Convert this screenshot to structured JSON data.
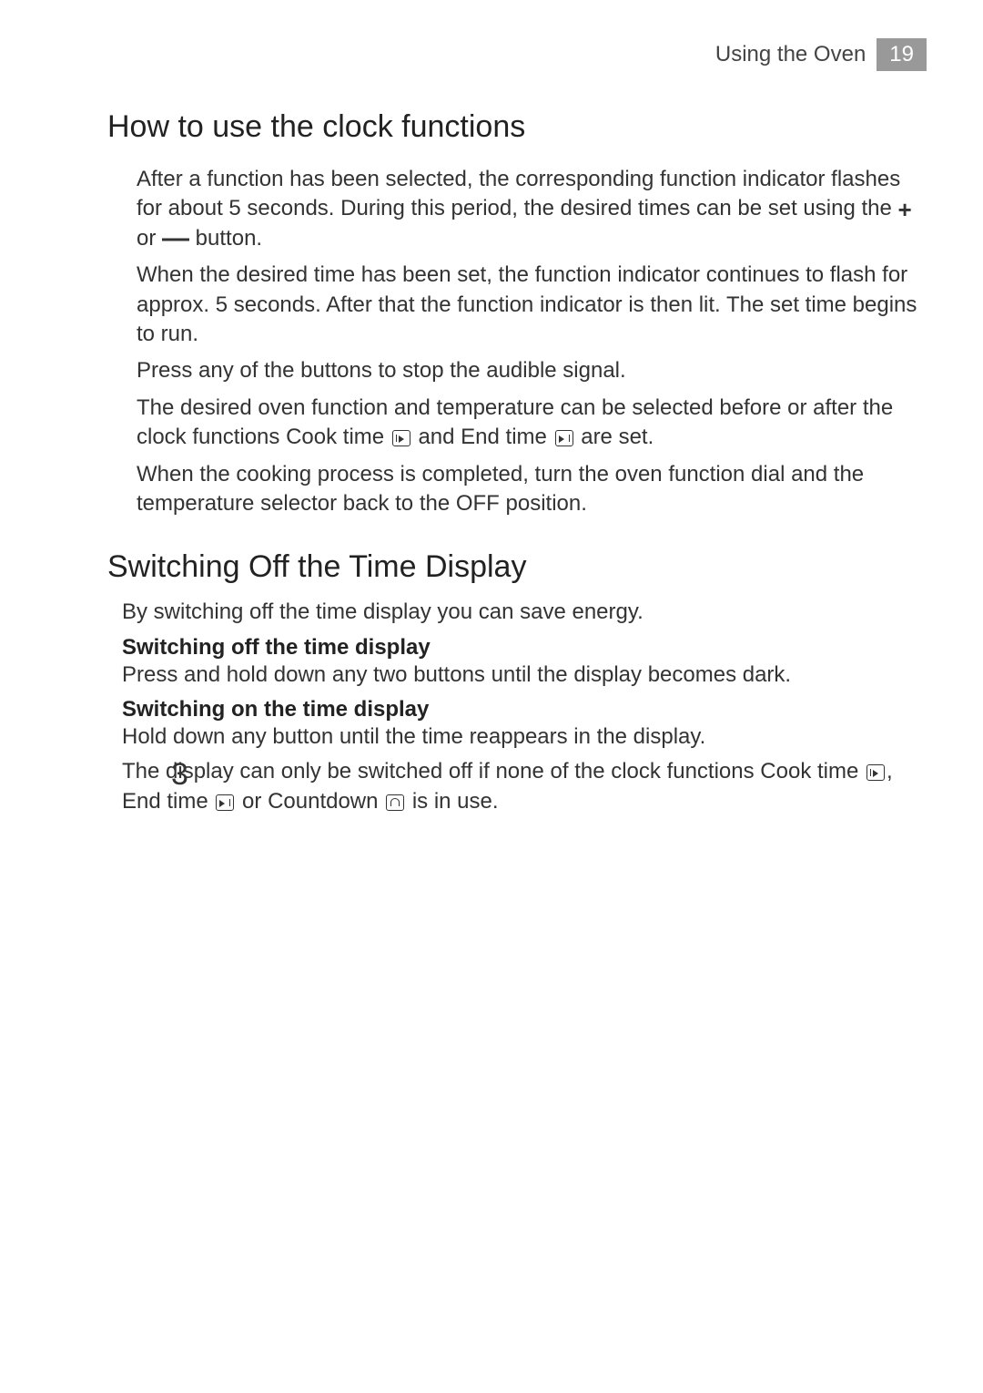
{
  "header": {
    "title": "Using the Oven",
    "page_number": "19"
  },
  "section1": {
    "heading": "How to use the clock functions",
    "p1a": "After a function has been selected, the corresponding function indicator flashes for about 5 seconds. During this period, the desired times can be set using the ",
    "p1b": " or ",
    "p1c": " button.",
    "p2": "When the desired time has been set, the function indicator continues to flash for approx. 5 seconds. After that the function indicator is then lit. The set time begins to run.",
    "p3": "Press any of the buttons to stop the audible signal.",
    "p4a": "The desired oven function and temperature can be selected before or after the clock functions Cook time ",
    "p4b": " and End time ",
    "p4c": " are set.",
    "p5": "When the cooking process is completed, turn the oven function dial and the temperature selector back to the OFF position."
  },
  "section2": {
    "heading": "Switching Off the Time Display",
    "intro": "By switching off the time display you can save energy.",
    "sub1_title": "Switching off the time display",
    "sub1_text": "Press and hold down any two buttons until the display becomes dark.",
    "sub2_title": "Switching on the time display",
    "sub2_text": "Hold down any button until the time reappears in the display.",
    "note_number": "3",
    "note_a": "The display can only be switched off if none of the clock functions Cook time ",
    "note_b": ", End time ",
    "note_c": " or Countdown ",
    "note_d": " is in use."
  },
  "symbols": {
    "plus": "+",
    "minus": "—"
  }
}
